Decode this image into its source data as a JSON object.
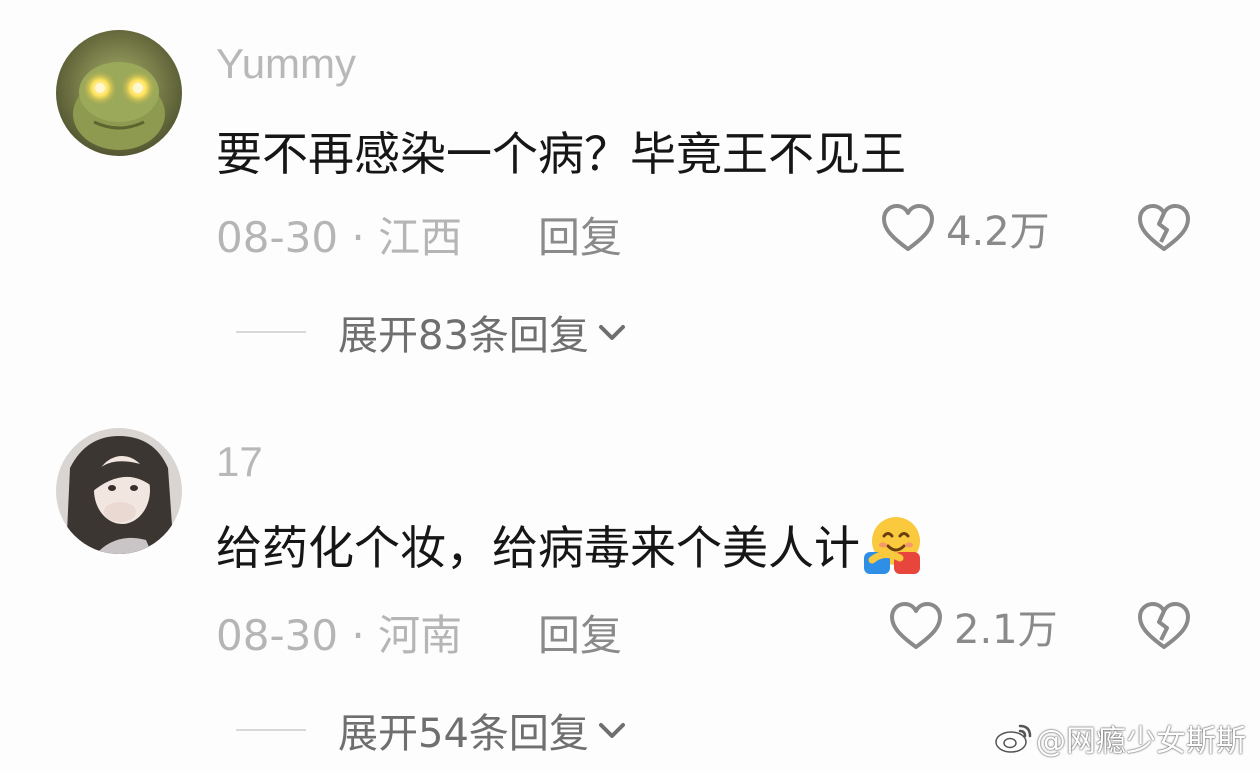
{
  "comments": [
    {
      "username": "Yummy",
      "text": "要不再感染一个病？毕竟王不见王",
      "date_location": "08-30 · 江西",
      "reply_label": "回复",
      "likes": "4.2万",
      "expand_label": "展开83条回复"
    },
    {
      "username": "17",
      "text": "给药化个妆，给病毒来个美人计",
      "emoji": "hugging-face-emoji",
      "date_location": "08-30 · 河南",
      "reply_label": "回复",
      "likes": "2.1万",
      "expand_label": "展开54条回复"
    }
  ],
  "watermark": "@网瘾少女斯斯",
  "icons": {
    "like": "heart-outline-icon",
    "dislike": "broken-heart-icon",
    "expand": "chevron-down-icon",
    "watermark": "weibo-logo-icon"
  },
  "colors": {
    "background": "#fdfdfd",
    "text": "#161616",
    "muted": "#b5b5b5",
    "icon": "#8a8a8a"
  }
}
